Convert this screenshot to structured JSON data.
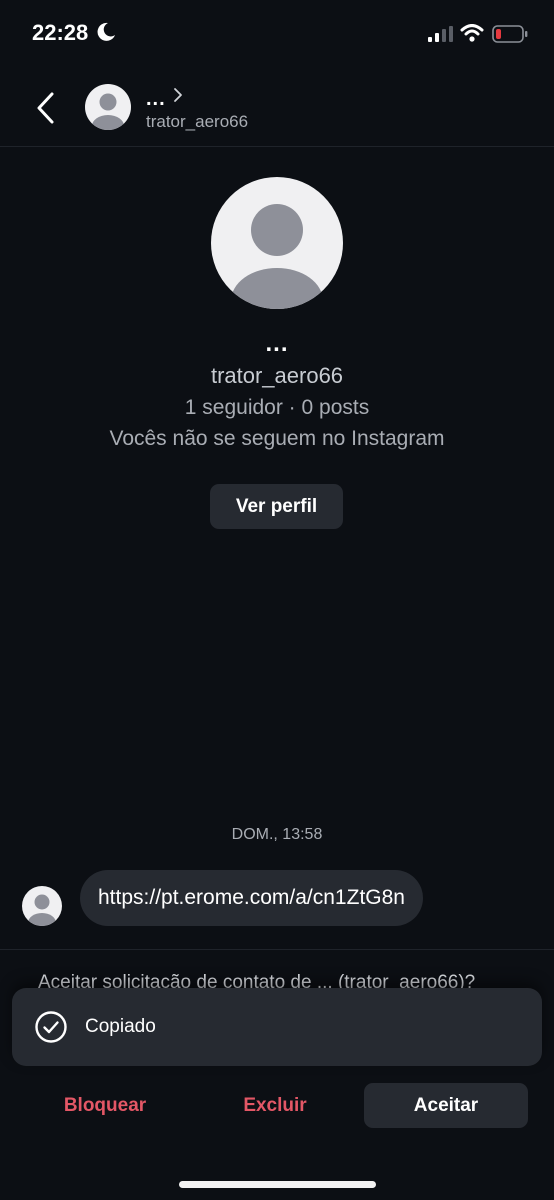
{
  "status_bar": {
    "time": "22:28",
    "icons": [
      "moon-icon",
      "signal-icon",
      "wifi-icon",
      "battery-low-icon"
    ]
  },
  "header": {
    "display_name": "...",
    "username": "trator_aero66",
    "icons": [
      "back-chevron-icon",
      "avatar-placeholder-icon",
      "chevron-right-icon"
    ]
  },
  "profile": {
    "display_name": "...",
    "username": "trator_aero66",
    "stats": "1 seguidor · 0 posts",
    "mutual_text": "Vocês não se seguem no Instagram",
    "view_profile_label": "Ver perfil"
  },
  "conversation": {
    "timestamp": "DOM., 13:58",
    "messages": [
      {
        "sender": "trator_aero66",
        "text": "https://pt.erome.com/a/cn1ZtG8n"
      }
    ]
  },
  "request": {
    "prompt": "Aceitar solicitação de contato de ... (trator_aero66)?"
  },
  "toast": {
    "text": "Copiado",
    "icon": "check-circle-icon"
  },
  "actions": {
    "block_label": "Bloquear",
    "delete_label": "Excluir",
    "accept_label": "Aceitar"
  },
  "colors": {
    "background": "#0c0f14",
    "surface": "#262a31",
    "destructive": "#e35766",
    "secondary_text": "#a9adb4"
  }
}
